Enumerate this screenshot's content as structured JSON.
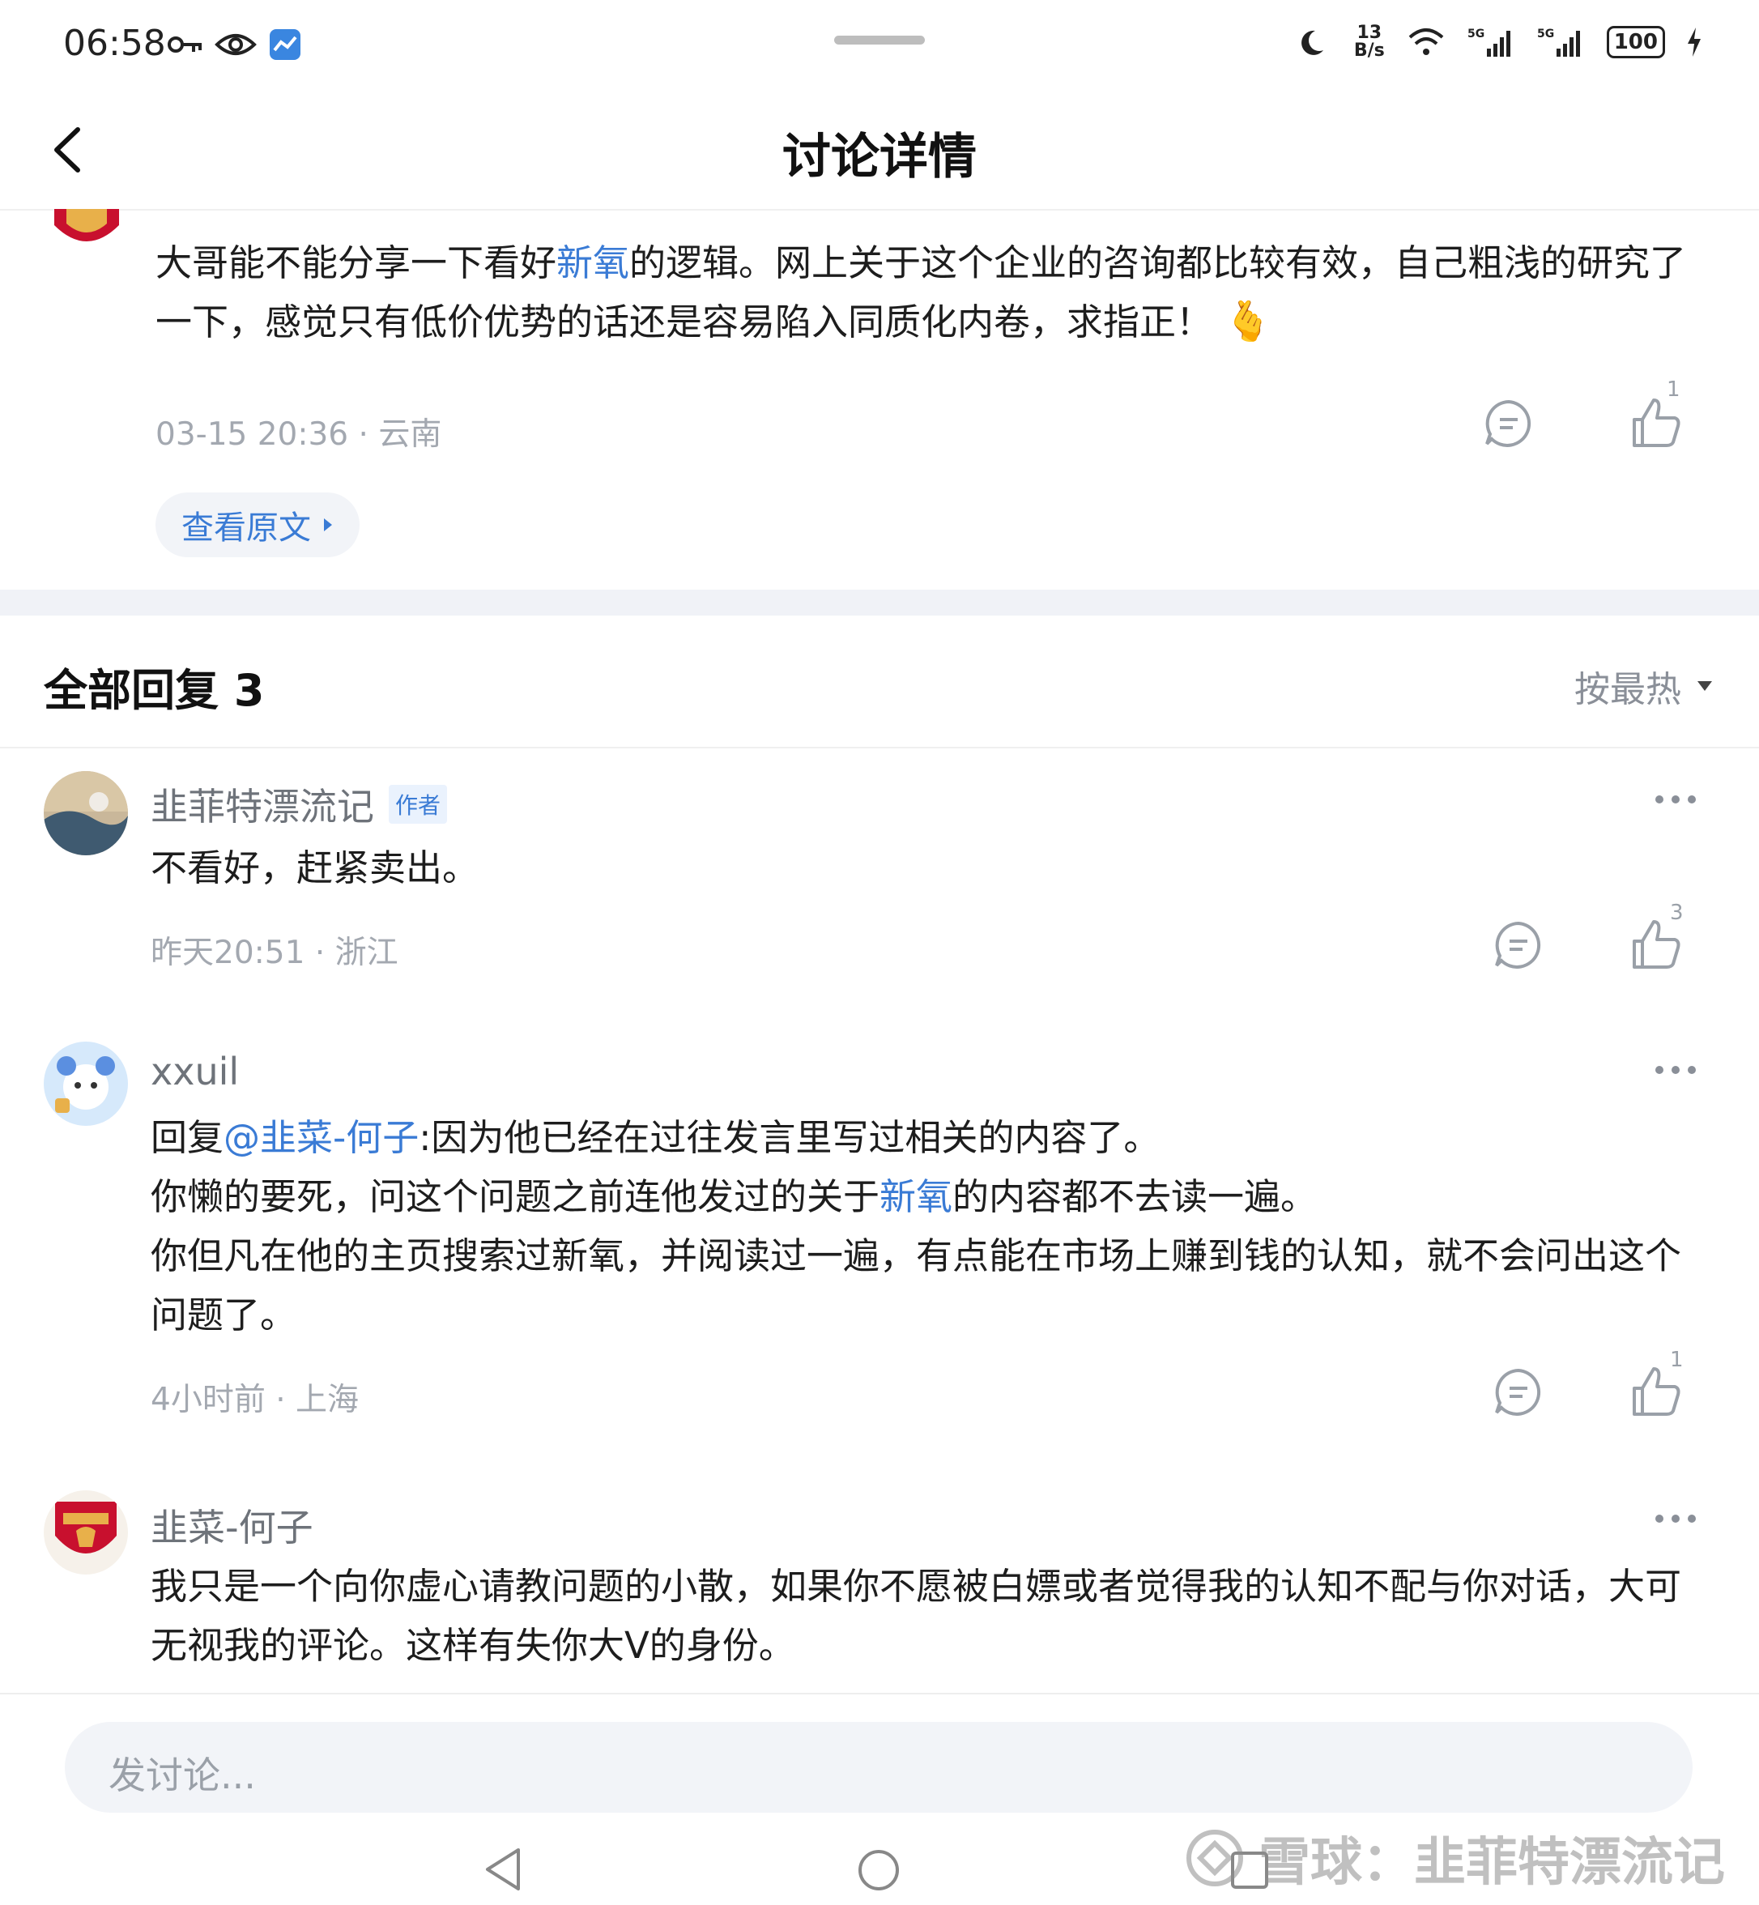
{
  "status_bar": {
    "time": "06:58",
    "net_speed_top": "13",
    "net_speed_bottom": "B/s",
    "battery": "100",
    "icons": [
      "key-icon",
      "eye-icon",
      "app-notify-icon",
      "moon-icon",
      "wifi-icon",
      "signal-5g-icon",
      "signal-5g-icon",
      "charging-icon"
    ]
  },
  "header": {
    "title": "讨论详情"
  },
  "post": {
    "text_before": "大哥能不能分享一下看好",
    "text_link": "新氧",
    "text_after": "的逻辑。网上关于这个企业的咨询都比较有效，自己粗浅的研究了一下，感觉只有低价优势的话还是容易陷入同质化内卷，求指正！",
    "emoji": "🫰",
    "timestamp": "03-15 20:36",
    "location": "云南",
    "like_count": "1",
    "view_original": "查看原文"
  },
  "replies_header": {
    "title": "全部回复",
    "count": "3",
    "sort_label": "按最热"
  },
  "replies": [
    {
      "username": "韭菲特漂流记",
      "badge": "作者",
      "text": "不看好，赶紧卖出。",
      "timestamp": "昨天20:51",
      "location": "浙江",
      "like_count": "3"
    },
    {
      "username": "xxuil",
      "line1_prefix": "回复",
      "line1_mention": "@韭菜-何子",
      "line1_rest": ":因为他已经在过往发言里写过相关的内容了。",
      "line2_before": "你懒的要死，问这个问题之前连他发过的关于",
      "line2_link": "新氧",
      "line2_after": "的内容都不去读一遍。",
      "line3": "你但凡在他的主页搜索过新氧，并阅读过一遍，有点能在市场上赚到钱的认知，就不会问出这个问题了。",
      "timestamp": "4小时前",
      "location": "上海",
      "like_count": "1"
    },
    {
      "username": "韭菜-何子",
      "text": "我只是一个向你虚心请教问题的小散，如果你不愿被白嫖或者觉得我的认知不配与你对话，大可无视我的评论。这样有失你大V的身份。"
    }
  ],
  "composer": {
    "placeholder": "发讨论..."
  },
  "watermark": {
    "text": "雪球：韭菲特漂流记"
  },
  "colors": {
    "accent": "#3a7bd5",
    "meta_gray": "#a3a8b0",
    "band": "#f0f2f7"
  }
}
